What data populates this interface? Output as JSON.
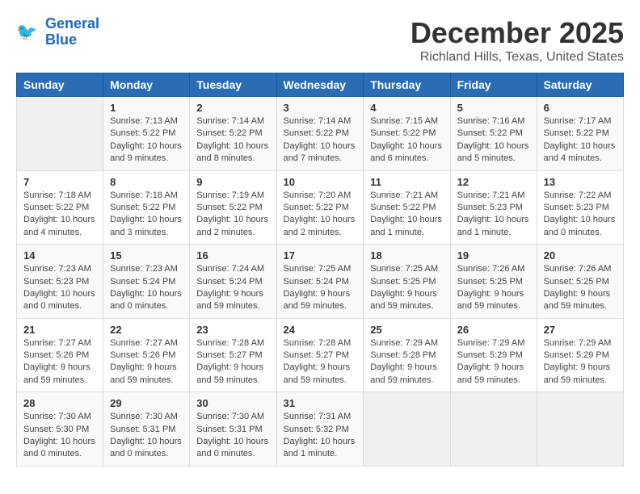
{
  "header": {
    "logo_line1": "General",
    "logo_line2": "Blue",
    "month": "December 2025",
    "location": "Richland Hills, Texas, United States"
  },
  "weekdays": [
    "Sunday",
    "Monday",
    "Tuesday",
    "Wednesday",
    "Thursday",
    "Friday",
    "Saturday"
  ],
  "weeks": [
    [
      {
        "day": "",
        "info": ""
      },
      {
        "day": "1",
        "info": "Sunrise: 7:13 AM\nSunset: 5:22 PM\nDaylight: 10 hours\nand 9 minutes."
      },
      {
        "day": "2",
        "info": "Sunrise: 7:14 AM\nSunset: 5:22 PM\nDaylight: 10 hours\nand 8 minutes."
      },
      {
        "day": "3",
        "info": "Sunrise: 7:14 AM\nSunset: 5:22 PM\nDaylight: 10 hours\nand 7 minutes."
      },
      {
        "day": "4",
        "info": "Sunrise: 7:15 AM\nSunset: 5:22 PM\nDaylight: 10 hours\nand 6 minutes."
      },
      {
        "day": "5",
        "info": "Sunrise: 7:16 AM\nSunset: 5:22 PM\nDaylight: 10 hours\nand 5 minutes."
      },
      {
        "day": "6",
        "info": "Sunrise: 7:17 AM\nSunset: 5:22 PM\nDaylight: 10 hours\nand 4 minutes."
      }
    ],
    [
      {
        "day": "7",
        "info": "Sunrise: 7:18 AM\nSunset: 5:22 PM\nDaylight: 10 hours\nand 4 minutes."
      },
      {
        "day": "8",
        "info": "Sunrise: 7:18 AM\nSunset: 5:22 PM\nDaylight: 10 hours\nand 3 minutes."
      },
      {
        "day": "9",
        "info": "Sunrise: 7:19 AM\nSunset: 5:22 PM\nDaylight: 10 hours\nand 2 minutes."
      },
      {
        "day": "10",
        "info": "Sunrise: 7:20 AM\nSunset: 5:22 PM\nDaylight: 10 hours\nand 2 minutes."
      },
      {
        "day": "11",
        "info": "Sunrise: 7:21 AM\nSunset: 5:22 PM\nDaylight: 10 hours\nand 1 minute."
      },
      {
        "day": "12",
        "info": "Sunrise: 7:21 AM\nSunset: 5:23 PM\nDaylight: 10 hours\nand 1 minute."
      },
      {
        "day": "13",
        "info": "Sunrise: 7:22 AM\nSunset: 5:23 PM\nDaylight: 10 hours\nand 0 minutes."
      }
    ],
    [
      {
        "day": "14",
        "info": "Sunrise: 7:23 AM\nSunset: 5:23 PM\nDaylight: 10 hours\nand 0 minutes."
      },
      {
        "day": "15",
        "info": "Sunrise: 7:23 AM\nSunset: 5:24 PM\nDaylight: 10 hours\nand 0 minutes."
      },
      {
        "day": "16",
        "info": "Sunrise: 7:24 AM\nSunset: 5:24 PM\nDaylight: 9 hours\nand 59 minutes."
      },
      {
        "day": "17",
        "info": "Sunrise: 7:25 AM\nSunset: 5:24 PM\nDaylight: 9 hours\nand 59 minutes."
      },
      {
        "day": "18",
        "info": "Sunrise: 7:25 AM\nSunset: 5:25 PM\nDaylight: 9 hours\nand 59 minutes."
      },
      {
        "day": "19",
        "info": "Sunrise: 7:26 AM\nSunset: 5:25 PM\nDaylight: 9 hours\nand 59 minutes."
      },
      {
        "day": "20",
        "info": "Sunrise: 7:26 AM\nSunset: 5:25 PM\nDaylight: 9 hours\nand 59 minutes."
      }
    ],
    [
      {
        "day": "21",
        "info": "Sunrise: 7:27 AM\nSunset: 5:26 PM\nDaylight: 9 hours\nand 59 minutes."
      },
      {
        "day": "22",
        "info": "Sunrise: 7:27 AM\nSunset: 5:26 PM\nDaylight: 9 hours\nand 59 minutes."
      },
      {
        "day": "23",
        "info": "Sunrise: 7:28 AM\nSunset: 5:27 PM\nDaylight: 9 hours\nand 59 minutes."
      },
      {
        "day": "24",
        "info": "Sunrise: 7:28 AM\nSunset: 5:27 PM\nDaylight: 9 hours\nand 59 minutes."
      },
      {
        "day": "25",
        "info": "Sunrise: 7:29 AM\nSunset: 5:28 PM\nDaylight: 9 hours\nand 59 minutes."
      },
      {
        "day": "26",
        "info": "Sunrise: 7:29 AM\nSunset: 5:29 PM\nDaylight: 9 hours\nand 59 minutes."
      },
      {
        "day": "27",
        "info": "Sunrise: 7:29 AM\nSunset: 5:29 PM\nDaylight: 9 hours\nand 59 minutes."
      }
    ],
    [
      {
        "day": "28",
        "info": "Sunrise: 7:30 AM\nSunset: 5:30 PM\nDaylight: 10 hours\nand 0 minutes."
      },
      {
        "day": "29",
        "info": "Sunrise: 7:30 AM\nSunset: 5:31 PM\nDaylight: 10 hours\nand 0 minutes."
      },
      {
        "day": "30",
        "info": "Sunrise: 7:30 AM\nSunset: 5:31 PM\nDaylight: 10 hours\nand 0 minutes."
      },
      {
        "day": "31",
        "info": "Sunrise: 7:31 AM\nSunset: 5:32 PM\nDaylight: 10 hours\nand 1 minute."
      },
      {
        "day": "",
        "info": ""
      },
      {
        "day": "",
        "info": ""
      },
      {
        "day": "",
        "info": ""
      }
    ]
  ]
}
